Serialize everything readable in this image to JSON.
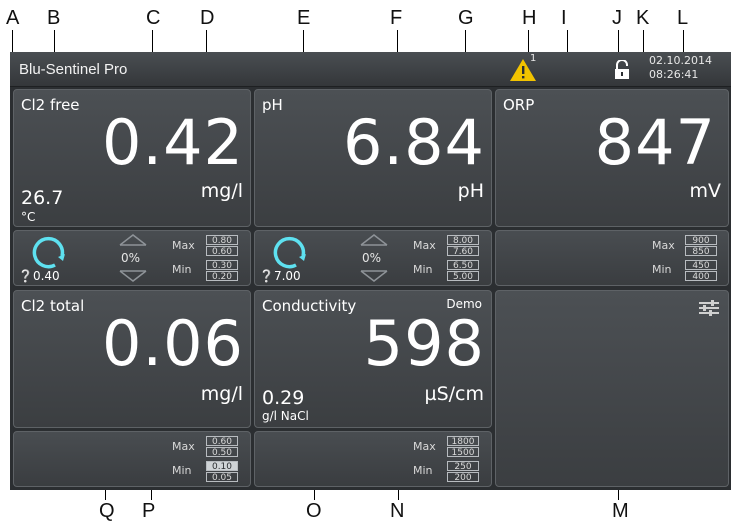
{
  "callouts_top": [
    "A",
    "B",
    "C",
    "D",
    "E",
    "F",
    "G",
    "H",
    "I",
    "J",
    "K",
    "L"
  ],
  "callouts_bottom": [
    "Q",
    "P",
    "O",
    "N",
    "M"
  ],
  "app": {
    "title": "Blu-Sentinel Pro",
    "date": "02.10.2014",
    "time": "08:26:41",
    "warning_count": "1"
  },
  "panels": {
    "cl2free": {
      "title": "Cl2 free",
      "value": "0.42",
      "unit": "mg/l",
      "secondary_value": "26.7",
      "secondary_unit": "°C"
    },
    "ph": {
      "title": "pH",
      "value": "6.84",
      "unit": "pH"
    },
    "orp": {
      "title": "ORP",
      "value": "847",
      "unit": "mV"
    },
    "cl2total": {
      "title": "Cl2 total",
      "value": "0.06",
      "unit": "mg/l"
    },
    "conductivity": {
      "title": "Conductivity",
      "badge": "Demo",
      "value": "598",
      "unit": "µS/cm",
      "secondary_value": "0.29",
      "secondary_unit": "g/l NaCl"
    }
  },
  "strips": {
    "cl2free": {
      "setpoint": "❔0.40",
      "percent": "0%",
      "max_label": "Max",
      "min_label": "Min",
      "max_values": [
        "0.80",
        "0.60"
      ],
      "min_values": [
        "0.30",
        "0.20"
      ]
    },
    "ph": {
      "setpoint": "❔7.00",
      "percent": "0%",
      "max_label": "Max",
      "min_label": "Min",
      "max_values": [
        "8.00",
        "7.60"
      ],
      "min_values": [
        "6.50",
        "5.00"
      ]
    },
    "orp": {
      "max_label": "Max",
      "min_label": "Min",
      "max_values": [
        "900",
        "850"
      ],
      "min_values": [
        "450",
        "400"
      ]
    },
    "cl2total": {
      "max_label": "Max",
      "min_label": "Min",
      "max_values": [
        "0.60",
        "0.50"
      ],
      "min_values": [
        "0.10",
        "0.05"
      ]
    },
    "conductivity": {
      "max_label": "Max",
      "min_label": "Min",
      "max_values": [
        "1800",
        "1500"
      ],
      "min_values": [
        "250",
        "200"
      ]
    }
  },
  "icons": {
    "warning": "warning-triangle-icon",
    "lock": "unlocked-padlock-icon",
    "settings": "sliders-settings-icon",
    "controller": "circular-arrow-icon",
    "updown": "up-down-arrows-icon"
  },
  "colors": {
    "screen_bg": "#2b2e31",
    "panel_bg": "#45494d",
    "ring": "#5ee1f0",
    "warning": "#f2c300",
    "text": "#ffffff"
  }
}
